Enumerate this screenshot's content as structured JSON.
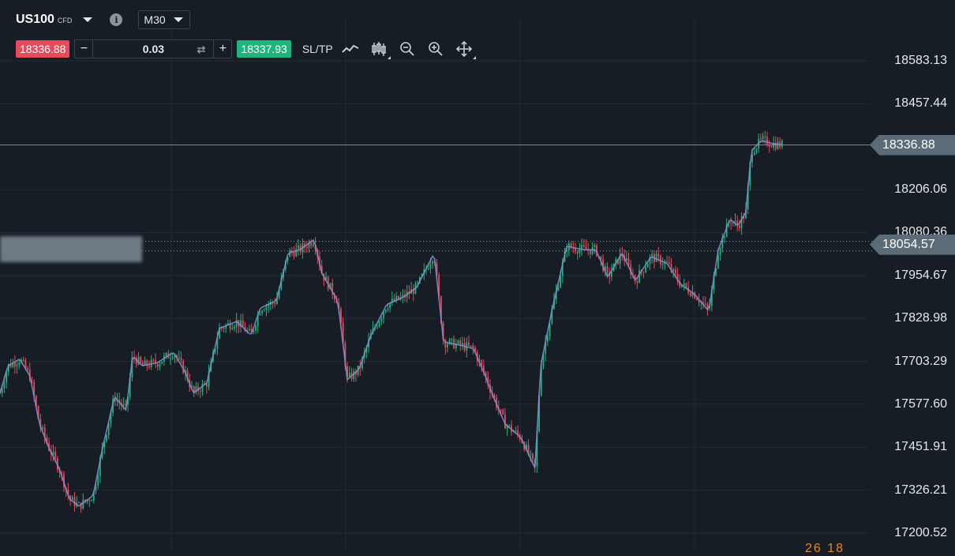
{
  "header": {
    "symbol": "US100",
    "symbol_tag": "CFD",
    "timeframe": "M30",
    "info_icon": "info-icon"
  },
  "order": {
    "sell_price": "18336.88",
    "buy_price": "18337.93",
    "quantity": "0.03",
    "sltp_label": "SL/TP"
  },
  "toolbar_icons": [
    "line-chart-icon",
    "candlestick-icon",
    "zoom-out-icon",
    "zoom-in-icon",
    "pan-move-icon"
  ],
  "price_axis": [
    "18583.13",
    "18457.44",
    "18206.06",
    "18080.36",
    "17954.67",
    "17828.98",
    "17703.29",
    "17577.60",
    "17451.91",
    "17326.21",
    "17200.52"
  ],
  "current_price_tag": "18336.88",
  "secondary_price_tag": "18054.57",
  "bottom_partial": "26 18",
  "colors": {
    "background": "#161d24",
    "bull": "#1db57d",
    "bear": "#e74a5b",
    "ma_line": "#8a8fd6",
    "grid": "#222b33",
    "price_tag": "#5b6c78"
  },
  "chart_data": {
    "type": "candlestick",
    "ylim": [
      17150,
      18640
    ],
    "grid": true,
    "current_price": 18336.88,
    "secondary_level": 18054.57,
    "anchors": [
      [
        0,
        17610
      ],
      [
        10,
        17690
      ],
      [
        25,
        17710
      ],
      [
        38,
        17660
      ],
      [
        50,
        17520
      ],
      [
        62,
        17450
      ],
      [
        75,
        17390
      ],
      [
        88,
        17300
      ],
      [
        100,
        17280
      ],
      [
        118,
        17310
      ],
      [
        130,
        17450
      ],
      [
        145,
        17600
      ],
      [
        160,
        17560
      ],
      [
        168,
        17720
      ],
      [
        180,
        17690
      ],
      [
        200,
        17700
      ],
      [
        220,
        17730
      ],
      [
        235,
        17670
      ],
      [
        245,
        17610
      ],
      [
        262,
        17640
      ],
      [
        278,
        17800
      ],
      [
        300,
        17820
      ],
      [
        318,
        17780
      ],
      [
        330,
        17860
      ],
      [
        350,
        17880
      ],
      [
        365,
        18020
      ],
      [
        380,
        18030
      ],
      [
        398,
        18060
      ],
      [
        408,
        17960
      ],
      [
        428,
        17880
      ],
      [
        440,
        17650
      ],
      [
        455,
        17680
      ],
      [
        470,
        17780
      ],
      [
        490,
        17870
      ],
      [
        510,
        17890
      ],
      [
        528,
        17920
      ],
      [
        550,
        18020
      ],
      [
        562,
        17760
      ],
      [
        585,
        17750
      ],
      [
        600,
        17740
      ],
      [
        615,
        17660
      ],
      [
        625,
        17600
      ],
      [
        640,
        17520
      ],
      [
        660,
        17480
      ],
      [
        678,
        17390
      ],
      [
        685,
        17690
      ],
      [
        700,
        17860
      ],
      [
        718,
        18040
      ],
      [
        740,
        18030
      ],
      [
        755,
        18030
      ],
      [
        770,
        17950
      ],
      [
        788,
        18020
      ],
      [
        805,
        17940
      ],
      [
        825,
        18010
      ],
      [
        845,
        17990
      ],
      [
        862,
        17930
      ],
      [
        880,
        17900
      ],
      [
        898,
        17850
      ],
      [
        910,
        18030
      ],
      [
        925,
        18120
      ],
      [
        935,
        18100
      ],
      [
        945,
        18140
      ],
      [
        952,
        18320
      ],
      [
        965,
        18350
      ],
      [
        980,
        18340
      ],
      [
        993,
        18336.88
      ]
    ],
    "candle_spacing": 2.7,
    "ma_color": "#8a8fd6"
  }
}
